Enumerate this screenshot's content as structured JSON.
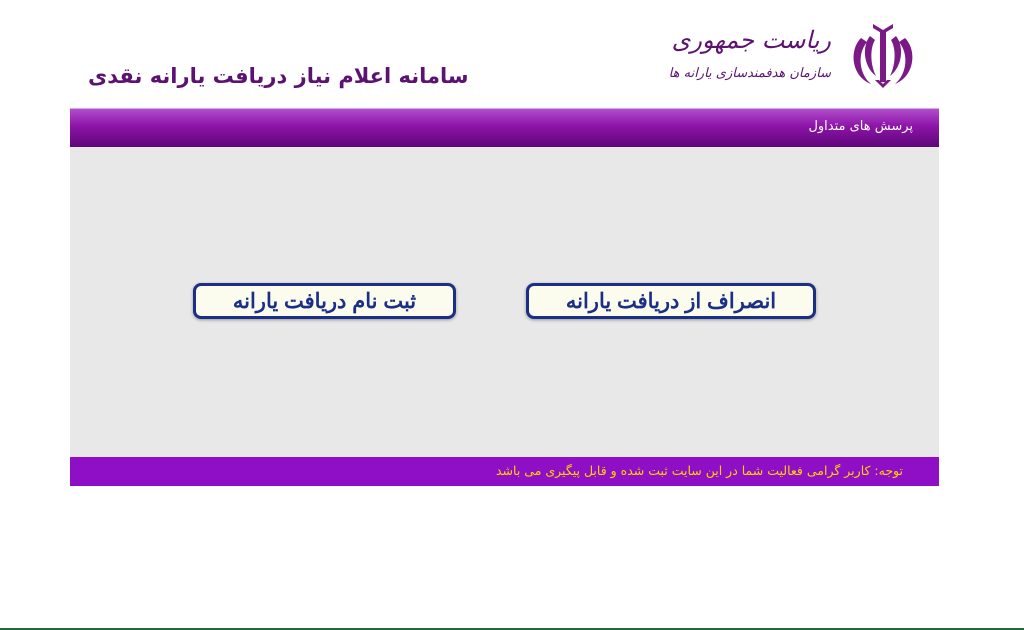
{
  "header": {
    "site_title": "سامانه اعلام نیاز دریافت یارانه نقدی",
    "org_title": "ریاست جمهوری",
    "org_subtitle": "سازمان هدفمندسازی یارانه ها",
    "emblem": "iran-emblem-icon",
    "brand_color": "#5c1270"
  },
  "navbar": {
    "items": [
      {
        "label": "پرسش های متداول"
      }
    ],
    "color": "#8d14a8"
  },
  "main": {
    "cancel_button": "انصراف از دریافت یارانه",
    "register_button": "ثبت نام دریافت یارانه",
    "button_color": "#1c2f86"
  },
  "footer": {
    "notice": "توجه: کاربر گرامی فعالیت شما در این سایت ثبت شده و قابل پیگیری می باشد",
    "notice_color": "#ffd200",
    "bar_color": "#8f0fc6"
  }
}
